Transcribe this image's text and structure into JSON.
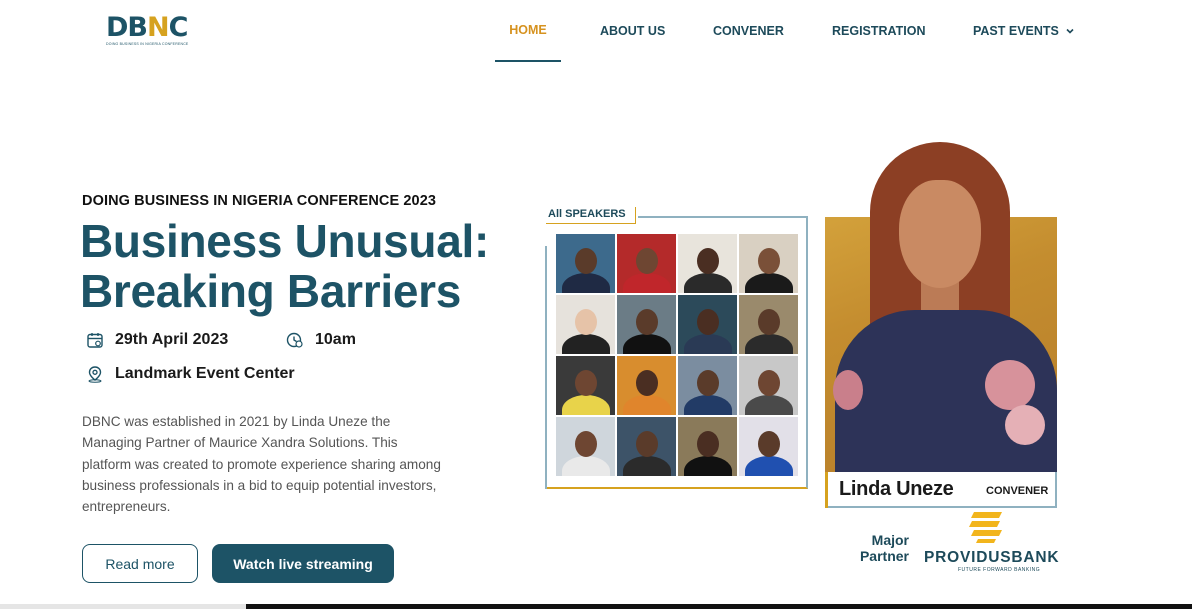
{
  "brand": {
    "logo_main": "DB",
    "logo_accent": "N",
    "logo_end": "C",
    "logo_tagline": "DOING BUSINESS IN NIGERIA CONFERENCE"
  },
  "nav": {
    "items": [
      {
        "label": "HOME",
        "active": true
      },
      {
        "label": "ABOUT US",
        "active": false
      },
      {
        "label": "CONVENER",
        "active": false
      },
      {
        "label": "REGISTRATION",
        "active": false
      },
      {
        "label": "PAST EVENTS",
        "active": false,
        "has_dropdown": true
      }
    ]
  },
  "hero": {
    "eyebrow": "DOING BUSINESS IN NIGERIA CONFERENCE 2023",
    "headline": "Business Unusual: Breaking Barriers",
    "date": "29th April 2023",
    "time": "10am",
    "venue": "Landmark Event Center",
    "description": "DBNC was established in 2021 by Linda Uneze the Managing Partner of Maurice Xandra Solutions. This platform was created to promote experience sharing among business professionals in a bid to equip potential investors, entrepreneurs.",
    "read_more": "Read more",
    "watch_live": "Watch live streaming"
  },
  "speakers": {
    "label": "All SPEAKERS",
    "count": 16
  },
  "convener": {
    "name": "Linda Uneze",
    "role": "CONVENER"
  },
  "partner": {
    "label": "Major Partner",
    "name": "PROVIDUSBANK",
    "tagline": "FUTURE FORWARD BANKING"
  },
  "colors": {
    "primary": "#1d5366",
    "accent": "#d6a21f",
    "active_nav": "#d6921f"
  },
  "icons": {
    "date": "calendar-icon",
    "time": "clock-icon",
    "venue": "location-pin-icon",
    "dropdown": "chevron-down-icon"
  }
}
